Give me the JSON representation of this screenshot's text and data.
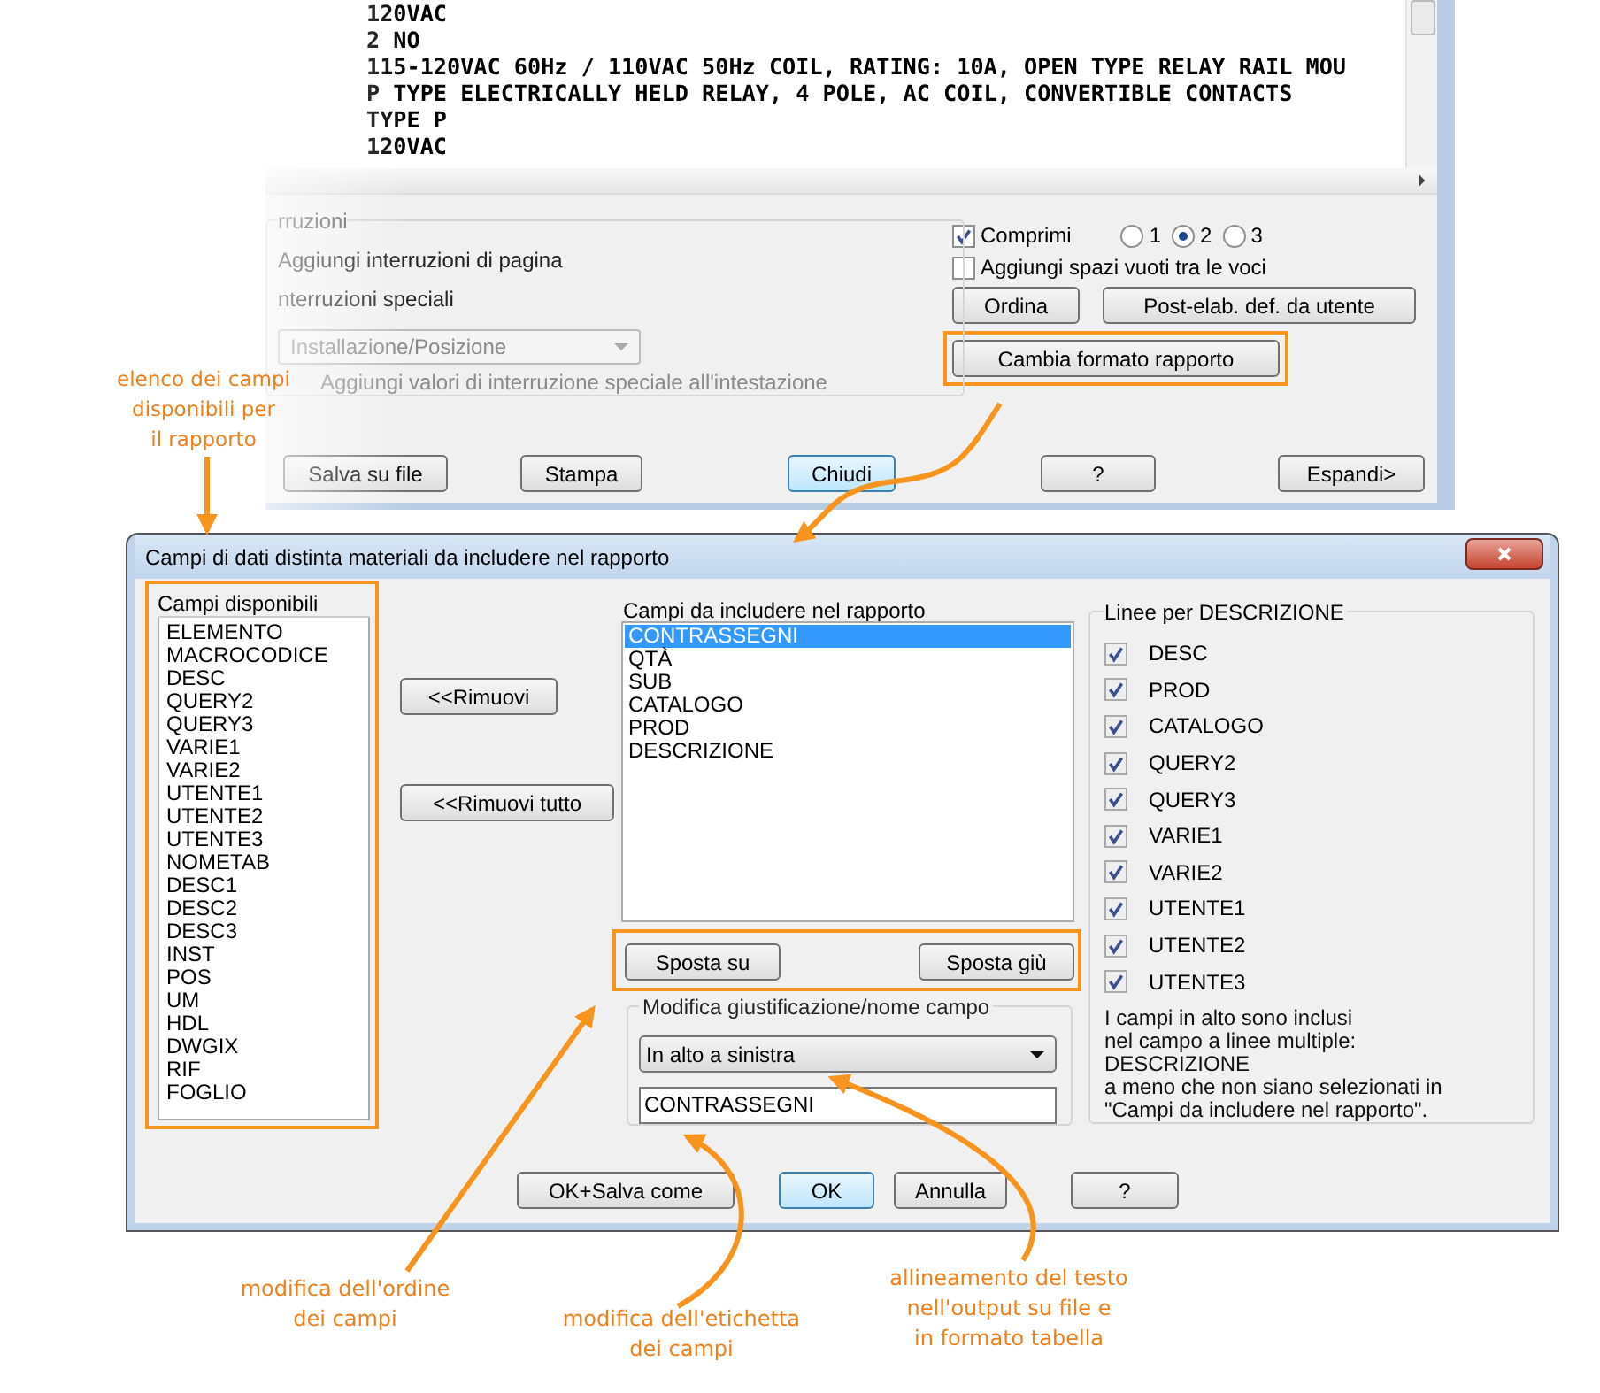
{
  "report_window": {
    "preview_lines": [
      "120VAC",
      "2 NO",
      "115-120VAC 60Hz / 110VAC 50Hz COIL, RATING: 10A, OPEN TYPE RELAY RAIL MOU",
      "P TYPE ELECTRICALLY HELD RELAY, 4 POLE, AC COIL, CONVERTIBLE CONTACTS",
      "TYPE P",
      "120VAC"
    ],
    "breaks_group": {
      "title": "rruzioni",
      "page_breaks": "Aggiungi interruzioni di pagina",
      "special_breaks": "nterruzioni speciali",
      "break_field": {
        "value": "Installazione/Posizione",
        "disabled": true
      },
      "add_break_values": {
        "label": "Aggiungi valori di interruzione speciale all'intestazione",
        "disabled": true
      }
    },
    "compress": {
      "label": "Comprimi",
      "checked": true
    },
    "compress_levels": [
      {
        "label": "1",
        "selected": false
      },
      {
        "label": "2",
        "selected": true
      },
      {
        "label": "3",
        "selected": false
      }
    ],
    "add_blank_lines": {
      "label": "Aggiungi spazi vuoti tra le voci",
      "checked": false
    },
    "action_buttons": [
      "Ordina",
      "Post-elab. def. da utente"
    ],
    "change_format_button": "Cambia formato rapporto",
    "footer_buttons": [
      {
        "label": "Salva su file",
        "focused": false
      },
      {
        "label": "Stampa",
        "focused": false
      },
      {
        "label": "Chiudi",
        "focused": true
      },
      {
        "label": "?",
        "focused": false
      },
      {
        "label": "Espandi>",
        "focused": false
      }
    ]
  },
  "fields_dialog": {
    "title": "Campi di dati distinta materiali da includere nel rapporto",
    "available_fields": {
      "header": "Campi disponibili",
      "items": [
        "ELEMENTO",
        "MACROCODICE",
        "DESC",
        "QUERY2",
        "QUERY3",
        "VARIE1",
        "VARIE2",
        "UTENTE1",
        "UTENTE2",
        "UTENTE3",
        "NOMETAB",
        "DESC1",
        "DESC2",
        "DESC3",
        "INST",
        "POS",
        "UM",
        "HDL",
        "DWGIX",
        "RIF",
        "FOGLIO"
      ]
    },
    "remove_buttons": [
      "<<Rimuovi",
      "<<Rimuovi tutto"
    ],
    "included_fields": {
      "header": "Campi da includere nel rapporto",
      "items": [
        {
          "label": "CONTRASSEGNI",
          "selected": true
        },
        {
          "label": "QTÀ",
          "selected": false
        },
        {
          "label": "SUB",
          "selected": false
        },
        {
          "label": "CATALOGO",
          "selected": false
        },
        {
          "label": "PROD",
          "selected": false
        },
        {
          "label": "DESCRIZIONE",
          "selected": false
        }
      ]
    },
    "move_buttons": [
      "Sposta su",
      "Sposta giù"
    ],
    "edit_group": {
      "title": "Modifica giustificazione/nome campo",
      "justification": "In alto a sinistra",
      "field_name": "CONTRASSEGNI"
    },
    "description_lines": {
      "title": "Linee per DESCRIZIONE",
      "items": [
        {
          "label": "DESC",
          "checked": true
        },
        {
          "label": "PROD",
          "checked": true
        },
        {
          "label": "CATALOGO",
          "checked": true
        },
        {
          "label": "QUERY2",
          "checked": true
        },
        {
          "label": "QUERY3",
          "checked": true
        },
        {
          "label": "VARIE1",
          "checked": true
        },
        {
          "label": "VARIE2",
          "checked": true
        },
        {
          "label": "UTENTE1",
          "checked": true
        },
        {
          "label": "UTENTE2",
          "checked": true
        },
        {
          "label": "UTENTE3",
          "checked": true
        }
      ],
      "note": "I campi in alto sono inclusi\nnel campo a linee multiple:\nDESCRIZIONE\na meno che non siano selezionati in\n\"Campi da includere nel rapporto\"."
    },
    "footer_buttons": [
      {
        "label": "OK+Salva come",
        "focused": false
      },
      {
        "label": "OK",
        "focused": true
      },
      {
        "label": "Annulla",
        "focused": false
      },
      {
        "label": "?",
        "focused": false
      }
    ]
  },
  "callouts": [
    "elenco dei campi\ndisponibili per\nil rapporto",
    "modifica dell'ordine\ndei campi",
    "modifica dell'etichetta\ndei campi",
    "allineamento del testo\nnell'output su file e\nin formato tabella"
  ]
}
